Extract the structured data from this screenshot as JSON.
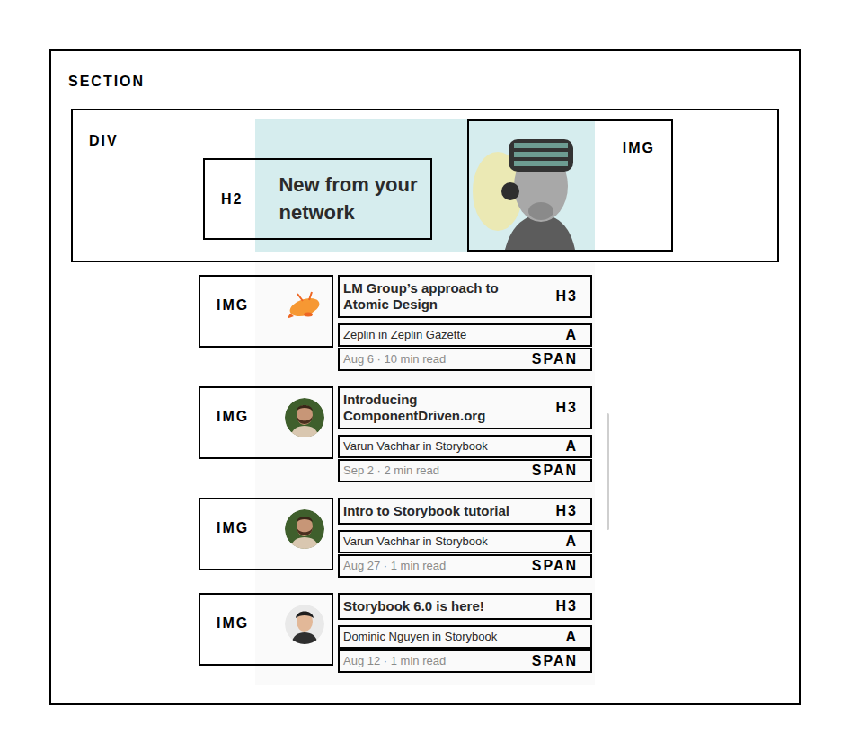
{
  "section": {
    "label": "SECTION"
  },
  "header": {
    "label": "DIV",
    "heading": {
      "label": "H2",
      "text": "New from your network"
    },
    "image": {
      "label": "IMG"
    }
  },
  "posts": [
    {
      "kind": "zeplin",
      "image_label": "IMG",
      "title": {
        "label": "H3",
        "text": "LM Group’s approach to Atomic Design"
      },
      "author": {
        "label": "A",
        "text": "Zeplin in Zeplin Gazette"
      },
      "meta": {
        "label": "SPAN",
        "text": "Aug 6 · 10 min read"
      }
    },
    {
      "kind": "bearded",
      "image_label": "IMG",
      "title": {
        "label": "H3",
        "text": "Introducing ComponentDriven.org"
      },
      "author": {
        "label": "A",
        "text": "Varun Vachhar in Storybook"
      },
      "meta": {
        "label": "SPAN",
        "text": "Sep 2 · 2 min read"
      }
    },
    {
      "kind": "bearded",
      "image_label": "IMG",
      "title": {
        "label": "H3",
        "text": "Intro to Storybook tutorial"
      },
      "author": {
        "label": "A",
        "text": "Varun Vachhar in Storybook"
      },
      "meta": {
        "label": "SPAN",
        "text": "Aug 27 · 1 min read"
      }
    },
    {
      "kind": "shaven",
      "image_label": "IMG",
      "title": {
        "label": "H3",
        "text": "Storybook 6.0 is here!"
      },
      "author": {
        "label": "A",
        "text": "Dominic Nguyen in Storybook"
      },
      "meta": {
        "label": "SPAN",
        "text": "Aug 12 · 1 min read"
      }
    }
  ]
}
